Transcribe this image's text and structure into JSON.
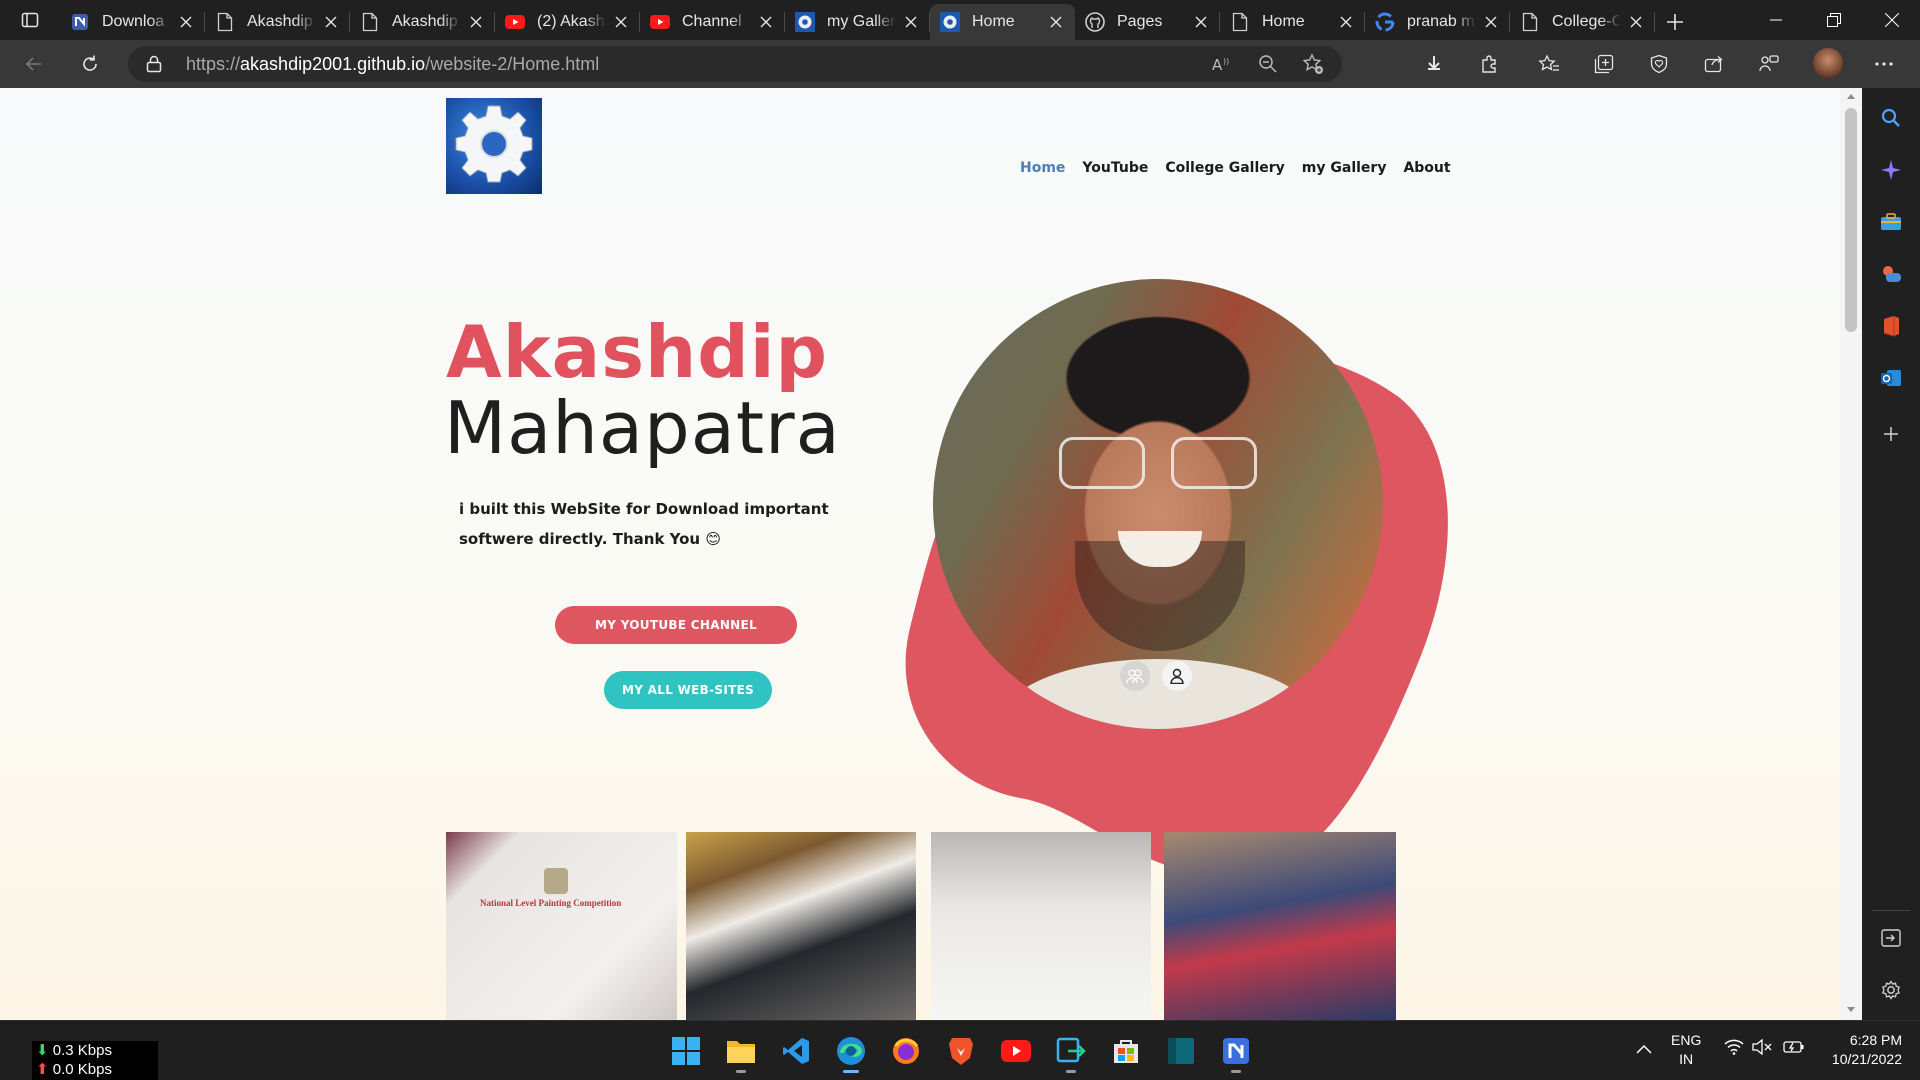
{
  "browser": {
    "tabs": [
      {
        "title": "Downloa",
        "favicon": "notion-n-icon",
        "active": false
      },
      {
        "title": "Akashdip",
        "favicon": "page-icon",
        "active": false
      },
      {
        "title": "Akashdip",
        "favicon": "page-icon",
        "active": false
      },
      {
        "title": "(2) Akash",
        "favicon": "youtube-icon",
        "active": false
      },
      {
        "title": "Channel",
        "favicon": "youtube-icon",
        "active": false
      },
      {
        "title": "my Galler",
        "favicon": "gear-icon",
        "active": false
      },
      {
        "title": "Home",
        "favicon": "gear-icon",
        "active": true
      },
      {
        "title": "Pages",
        "favicon": "github-icon",
        "active": false
      },
      {
        "title": "Home",
        "favicon": "page-icon",
        "active": false
      },
      {
        "title": "pranab m",
        "favicon": "google-icon",
        "active": false
      },
      {
        "title": "College-C",
        "favicon": "page-icon",
        "active": false
      }
    ],
    "url_prefix": "https://",
    "url_host": "akashdip2001.github.io",
    "url_path": "/website-2/Home.html"
  },
  "page": {
    "nav": [
      {
        "label": "Home",
        "active": true
      },
      {
        "label": "YouTube",
        "active": false
      },
      {
        "label": "College Gallery",
        "active": false
      },
      {
        "label": "my Gallery",
        "active": false
      },
      {
        "label": "About",
        "active": false
      }
    ],
    "first_name": "Akashdip",
    "last_name": "Mahapatra",
    "intro": "i built this WebSite for Download important softwere directly. Thank You 😊",
    "youtube_button": "MY YOUTUBE CHANNEL",
    "websites_button": "MY ALL WEB-SITES",
    "certificate_title": "National Level Painting Competition",
    "colors": {
      "accent_red": "#dd5660",
      "accent_teal": "#2fc3c2",
      "nav_active": "#4c7fb5"
    }
  },
  "taskbar": {
    "download_speed": "0.3 Kbps",
    "upload_speed": "0.0 Kbps",
    "language": "ENG",
    "region": "IN",
    "time": "6:28 PM",
    "date": "10/21/2022"
  }
}
